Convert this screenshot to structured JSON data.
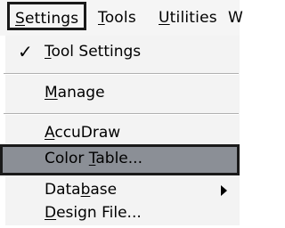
{
  "menubar": {
    "settings": {
      "pre": "",
      "acc": "S",
      "post": "ettings"
    },
    "tools": {
      "pre": "",
      "acc": "T",
      "post": "ools"
    },
    "utilities": {
      "pre": "",
      "acc": "U",
      "post": "tilities"
    },
    "w": "W"
  },
  "dropdown": {
    "tool_settings": {
      "pre": "",
      "acc": "T",
      "post": "ool Settings",
      "checked": "✓"
    },
    "manage": {
      "pre": "",
      "acc": "M",
      "post": "anage"
    },
    "accudraw": {
      "pre": "",
      "acc": "A",
      "post": "ccuDraw"
    },
    "color_table": {
      "pre": "Color ",
      "acc": "T",
      "post": "able..."
    },
    "database": {
      "pre": "Data",
      "acc": "b",
      "post": "ase"
    },
    "design_file": {
      "pre": "",
      "acc": "D",
      "post": "esign File..."
    }
  }
}
